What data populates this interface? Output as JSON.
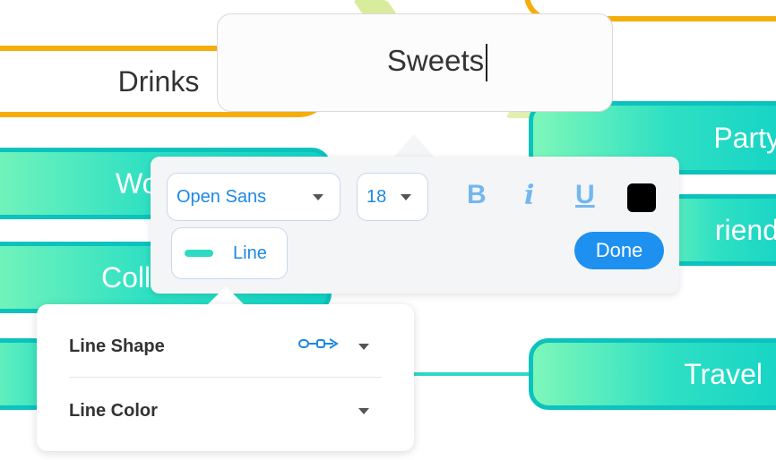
{
  "nodes": {
    "drinks": "Drinks",
    "party": "Party",
    "friends": "riends",
    "travel": "Travel",
    "work": "Wo",
    "college": "Colle"
  },
  "editor": {
    "text": "Sweets"
  },
  "toolbar": {
    "font_family": "Open Sans",
    "font_size": "18",
    "bold_label": "B",
    "italic_label": "i",
    "underline_label": "U",
    "text_color": "#000000",
    "line_label": "Line",
    "done_label": "Done"
  },
  "line_popup": {
    "shape_label": "Line Shape",
    "color_label": "Line Color"
  },
  "colors": {
    "accent": "#1e90f0",
    "node_teal": "#2fe0c3",
    "node_border": "#0bc2bd",
    "branch_yellow": "#f5ad0b"
  }
}
